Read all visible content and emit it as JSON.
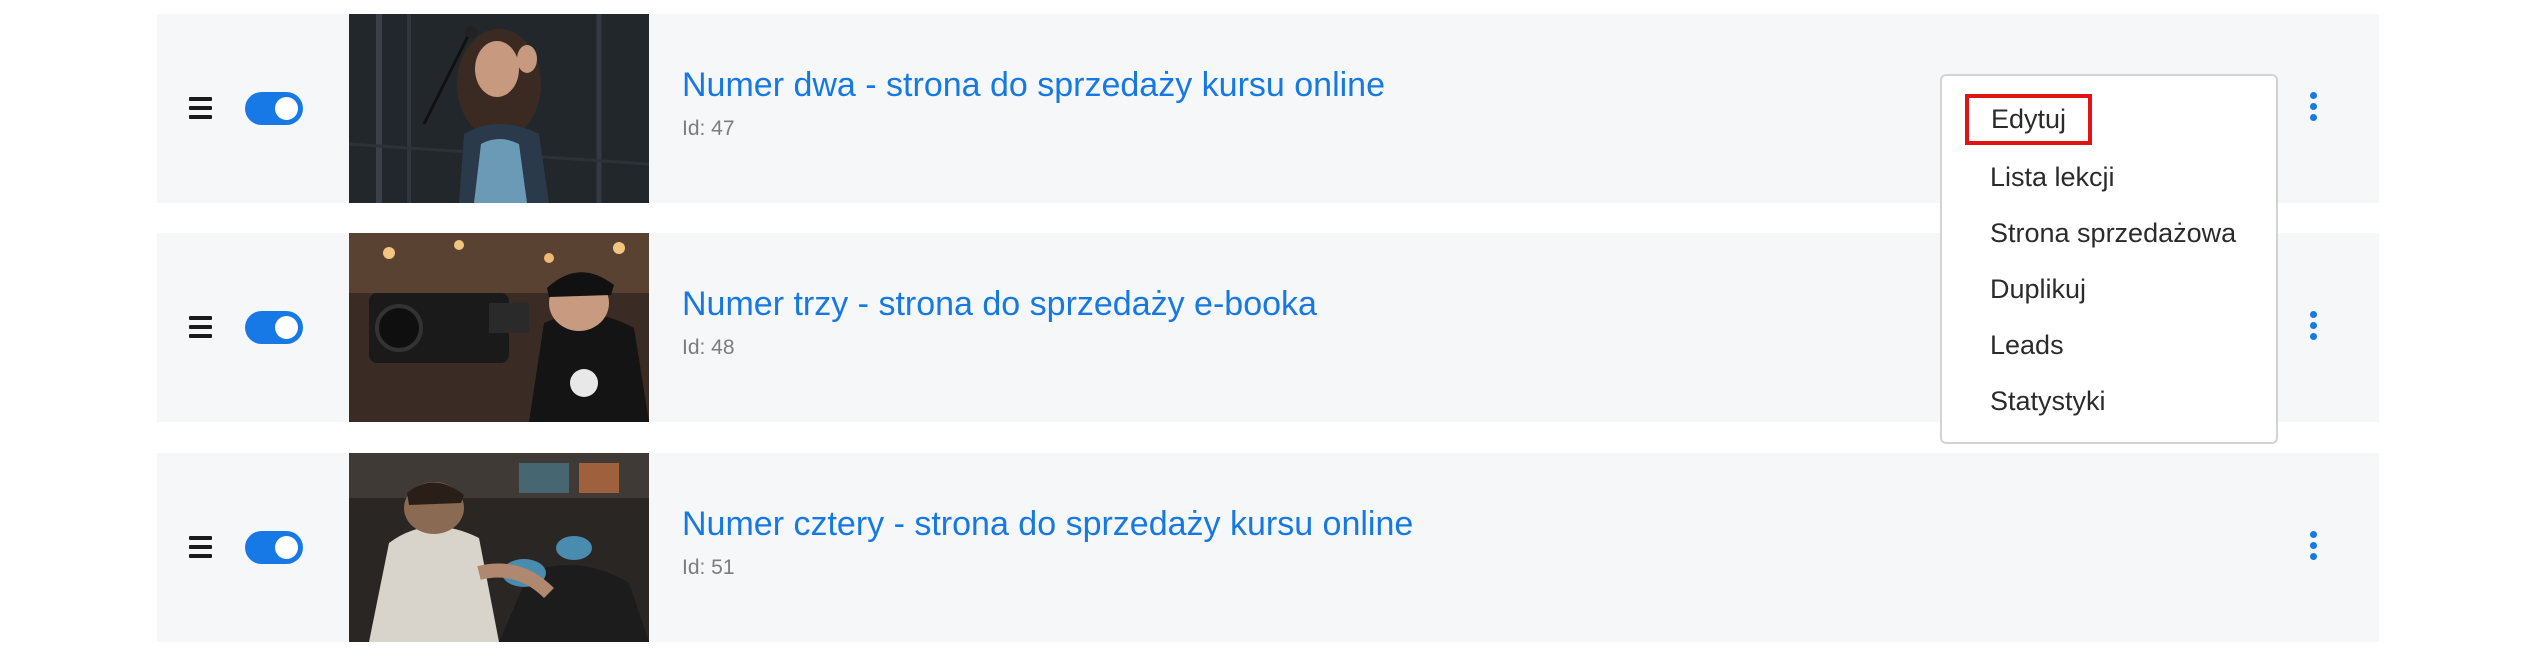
{
  "courses": [
    {
      "title": "Numer dwa - strona do sprzedaży kursu online",
      "id_text": "Id: 47",
      "enabled": true,
      "thumb_icon": "singer-photo"
    },
    {
      "title": "Numer trzy - strona do sprzedaży e-booka",
      "id_text": "Id: 48",
      "enabled": true,
      "thumb_icon": "camera-operator-photo"
    },
    {
      "title": "Numer cztery - strona do sprzedaży kursu online",
      "id_text": "Id: 51",
      "enabled": true,
      "thumb_icon": "tattoo-artist-photo"
    }
  ],
  "menu": {
    "items": [
      "Edytuj",
      "Lista lekcji",
      "Strona sprzedażowa",
      "Duplikuj",
      "Leads",
      "Statystyki"
    ],
    "highlighted_index": 0
  },
  "colors": {
    "accent": "#1779e6",
    "row_bg": "#f6f7f8",
    "highlight_border": "#e11414"
  }
}
